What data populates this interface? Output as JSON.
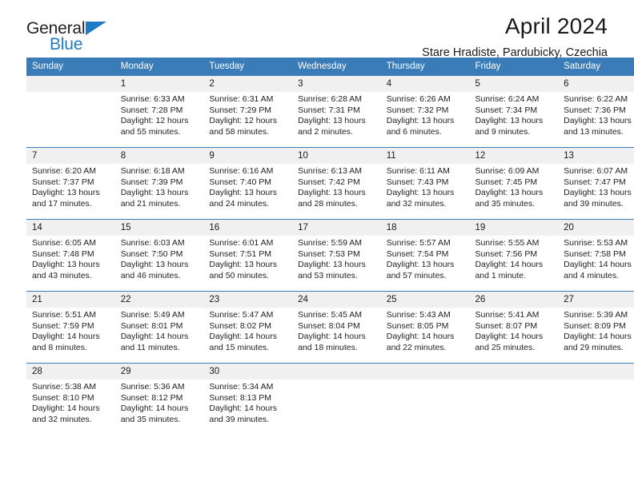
{
  "brand": {
    "name_part1": "General",
    "name_part2": "Blue",
    "triangle_color": "#1f7ac4",
    "text_color": "#231f20"
  },
  "header": {
    "title": "April 2024",
    "subtitle": "Stare Hradiste, Pardubicky, Czechia"
  },
  "calendar": {
    "header_bg": "#3a7cb8",
    "header_text_color": "#ffffff",
    "daynum_bg": "#f0f0f0",
    "weekday_headers": [
      "Sunday",
      "Monday",
      "Tuesday",
      "Wednesday",
      "Thursday",
      "Friday",
      "Saturday"
    ],
    "weeks": [
      [
        {
          "day": "",
          "sunrise": "",
          "sunset": "",
          "daylight_line1": "",
          "daylight_line2": ""
        },
        {
          "day": "1",
          "sunrise": "Sunrise: 6:33 AM",
          "sunset": "Sunset: 7:28 PM",
          "daylight_line1": "Daylight: 12 hours",
          "daylight_line2": "and 55 minutes."
        },
        {
          "day": "2",
          "sunrise": "Sunrise: 6:31 AM",
          "sunset": "Sunset: 7:29 PM",
          "daylight_line1": "Daylight: 12 hours",
          "daylight_line2": "and 58 minutes."
        },
        {
          "day": "3",
          "sunrise": "Sunrise: 6:28 AM",
          "sunset": "Sunset: 7:31 PM",
          "daylight_line1": "Daylight: 13 hours",
          "daylight_line2": "and 2 minutes."
        },
        {
          "day": "4",
          "sunrise": "Sunrise: 6:26 AM",
          "sunset": "Sunset: 7:32 PM",
          "daylight_line1": "Daylight: 13 hours",
          "daylight_line2": "and 6 minutes."
        },
        {
          "day": "5",
          "sunrise": "Sunrise: 6:24 AM",
          "sunset": "Sunset: 7:34 PM",
          "daylight_line1": "Daylight: 13 hours",
          "daylight_line2": "and 9 minutes."
        },
        {
          "day": "6",
          "sunrise": "Sunrise: 6:22 AM",
          "sunset": "Sunset: 7:36 PM",
          "daylight_line1": "Daylight: 13 hours",
          "daylight_line2": "and 13 minutes."
        }
      ],
      [
        {
          "day": "7",
          "sunrise": "Sunrise: 6:20 AM",
          "sunset": "Sunset: 7:37 PM",
          "daylight_line1": "Daylight: 13 hours",
          "daylight_line2": "and 17 minutes."
        },
        {
          "day": "8",
          "sunrise": "Sunrise: 6:18 AM",
          "sunset": "Sunset: 7:39 PM",
          "daylight_line1": "Daylight: 13 hours",
          "daylight_line2": "and 21 minutes."
        },
        {
          "day": "9",
          "sunrise": "Sunrise: 6:16 AM",
          "sunset": "Sunset: 7:40 PM",
          "daylight_line1": "Daylight: 13 hours",
          "daylight_line2": "and 24 minutes."
        },
        {
          "day": "10",
          "sunrise": "Sunrise: 6:13 AM",
          "sunset": "Sunset: 7:42 PM",
          "daylight_line1": "Daylight: 13 hours",
          "daylight_line2": "and 28 minutes."
        },
        {
          "day": "11",
          "sunrise": "Sunrise: 6:11 AM",
          "sunset": "Sunset: 7:43 PM",
          "daylight_line1": "Daylight: 13 hours",
          "daylight_line2": "and 32 minutes."
        },
        {
          "day": "12",
          "sunrise": "Sunrise: 6:09 AM",
          "sunset": "Sunset: 7:45 PM",
          "daylight_line1": "Daylight: 13 hours",
          "daylight_line2": "and 35 minutes."
        },
        {
          "day": "13",
          "sunrise": "Sunrise: 6:07 AM",
          "sunset": "Sunset: 7:47 PM",
          "daylight_line1": "Daylight: 13 hours",
          "daylight_line2": "and 39 minutes."
        }
      ],
      [
        {
          "day": "14",
          "sunrise": "Sunrise: 6:05 AM",
          "sunset": "Sunset: 7:48 PM",
          "daylight_line1": "Daylight: 13 hours",
          "daylight_line2": "and 43 minutes."
        },
        {
          "day": "15",
          "sunrise": "Sunrise: 6:03 AM",
          "sunset": "Sunset: 7:50 PM",
          "daylight_line1": "Daylight: 13 hours",
          "daylight_line2": "and 46 minutes."
        },
        {
          "day": "16",
          "sunrise": "Sunrise: 6:01 AM",
          "sunset": "Sunset: 7:51 PM",
          "daylight_line1": "Daylight: 13 hours",
          "daylight_line2": "and 50 minutes."
        },
        {
          "day": "17",
          "sunrise": "Sunrise: 5:59 AM",
          "sunset": "Sunset: 7:53 PM",
          "daylight_line1": "Daylight: 13 hours",
          "daylight_line2": "and 53 minutes."
        },
        {
          "day": "18",
          "sunrise": "Sunrise: 5:57 AM",
          "sunset": "Sunset: 7:54 PM",
          "daylight_line1": "Daylight: 13 hours",
          "daylight_line2": "and 57 minutes."
        },
        {
          "day": "19",
          "sunrise": "Sunrise: 5:55 AM",
          "sunset": "Sunset: 7:56 PM",
          "daylight_line1": "Daylight: 14 hours",
          "daylight_line2": "and 1 minute."
        },
        {
          "day": "20",
          "sunrise": "Sunrise: 5:53 AM",
          "sunset": "Sunset: 7:58 PM",
          "daylight_line1": "Daylight: 14 hours",
          "daylight_line2": "and 4 minutes."
        }
      ],
      [
        {
          "day": "21",
          "sunrise": "Sunrise: 5:51 AM",
          "sunset": "Sunset: 7:59 PM",
          "daylight_line1": "Daylight: 14 hours",
          "daylight_line2": "and 8 minutes."
        },
        {
          "day": "22",
          "sunrise": "Sunrise: 5:49 AM",
          "sunset": "Sunset: 8:01 PM",
          "daylight_line1": "Daylight: 14 hours",
          "daylight_line2": "and 11 minutes."
        },
        {
          "day": "23",
          "sunrise": "Sunrise: 5:47 AM",
          "sunset": "Sunset: 8:02 PM",
          "daylight_line1": "Daylight: 14 hours",
          "daylight_line2": "and 15 minutes."
        },
        {
          "day": "24",
          "sunrise": "Sunrise: 5:45 AM",
          "sunset": "Sunset: 8:04 PM",
          "daylight_line1": "Daylight: 14 hours",
          "daylight_line2": "and 18 minutes."
        },
        {
          "day": "25",
          "sunrise": "Sunrise: 5:43 AM",
          "sunset": "Sunset: 8:05 PM",
          "daylight_line1": "Daylight: 14 hours",
          "daylight_line2": "and 22 minutes."
        },
        {
          "day": "26",
          "sunrise": "Sunrise: 5:41 AM",
          "sunset": "Sunset: 8:07 PM",
          "daylight_line1": "Daylight: 14 hours",
          "daylight_line2": "and 25 minutes."
        },
        {
          "day": "27",
          "sunrise": "Sunrise: 5:39 AM",
          "sunset": "Sunset: 8:09 PM",
          "daylight_line1": "Daylight: 14 hours",
          "daylight_line2": "and 29 minutes."
        }
      ],
      [
        {
          "day": "28",
          "sunrise": "Sunrise: 5:38 AM",
          "sunset": "Sunset: 8:10 PM",
          "daylight_line1": "Daylight: 14 hours",
          "daylight_line2": "and 32 minutes."
        },
        {
          "day": "29",
          "sunrise": "Sunrise: 5:36 AM",
          "sunset": "Sunset: 8:12 PM",
          "daylight_line1": "Daylight: 14 hours",
          "daylight_line2": "and 35 minutes."
        },
        {
          "day": "30",
          "sunrise": "Sunrise: 5:34 AM",
          "sunset": "Sunset: 8:13 PM",
          "daylight_line1": "Daylight: 14 hours",
          "daylight_line2": "and 39 minutes."
        },
        {
          "day": "",
          "sunrise": "",
          "sunset": "",
          "daylight_line1": "",
          "daylight_line2": ""
        },
        {
          "day": "",
          "sunrise": "",
          "sunset": "",
          "daylight_line1": "",
          "daylight_line2": ""
        },
        {
          "day": "",
          "sunrise": "",
          "sunset": "",
          "daylight_line1": "",
          "daylight_line2": ""
        },
        {
          "day": "",
          "sunrise": "",
          "sunset": "",
          "daylight_line1": "",
          "daylight_line2": ""
        }
      ]
    ]
  }
}
